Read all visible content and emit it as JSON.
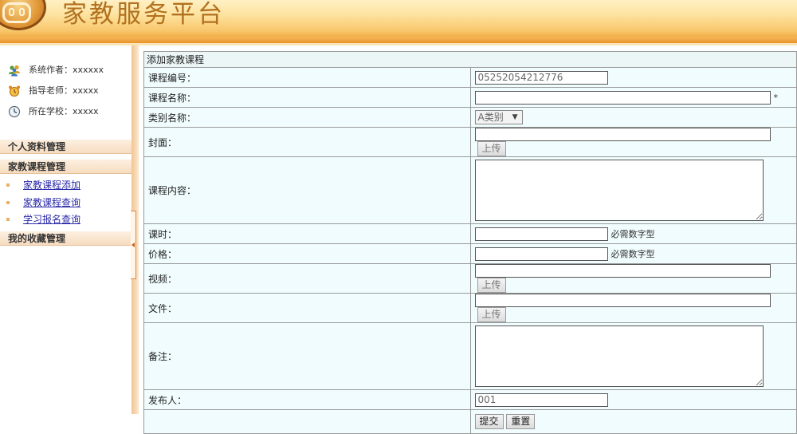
{
  "header": {
    "title": "家教服务平台"
  },
  "sidebar": {
    "info": [
      {
        "icon": "users-icon",
        "text": "系统作者：xxxxxx"
      },
      {
        "icon": "alarm-clock-icon",
        "text": "指导老师：xxxxx"
      },
      {
        "icon": "clock-icon",
        "text": "所在学校：xxxxx"
      }
    ],
    "sections": [
      {
        "label": "个人资料管理"
      },
      {
        "label": "家教课程管理"
      },
      {
        "label": "我的收藏管理"
      }
    ],
    "links": [
      {
        "label": "家教课程添加"
      },
      {
        "label": "家教课程查询"
      },
      {
        "label": "学习报名查询"
      }
    ]
  },
  "form": {
    "caption": "添加家教课程",
    "fields": {
      "code": {
        "label": "课程编号：",
        "value": "05252054212776"
      },
      "name": {
        "label": "课程名称：",
        "value": "",
        "required_mark": "*"
      },
      "category": {
        "label": "类别名称：",
        "selected": "A类别"
      },
      "cover": {
        "label": "封面：",
        "value": "",
        "button": "上传"
      },
      "content": {
        "label": "课程内容：",
        "value": ""
      },
      "hours": {
        "label": "课时：",
        "value": "",
        "hint": "必需数字型"
      },
      "price": {
        "label": "价格：",
        "value": "",
        "hint": "必需数字型"
      },
      "video": {
        "label": "视频：",
        "value": "",
        "button": "上传"
      },
      "file": {
        "label": "文件：",
        "value": "",
        "button": "上传"
      },
      "remark": {
        "label": "备注：",
        "value": ""
      },
      "publisher": {
        "label": "发布人：",
        "value": "001"
      }
    },
    "submit_label": "提交",
    "reset_label": "重置"
  },
  "colors": {
    "header_gold": "#b2711e",
    "cell_bg": "#f0fcfd",
    "link": "#2a2aa8",
    "section_bg": "#f6dcc0"
  }
}
